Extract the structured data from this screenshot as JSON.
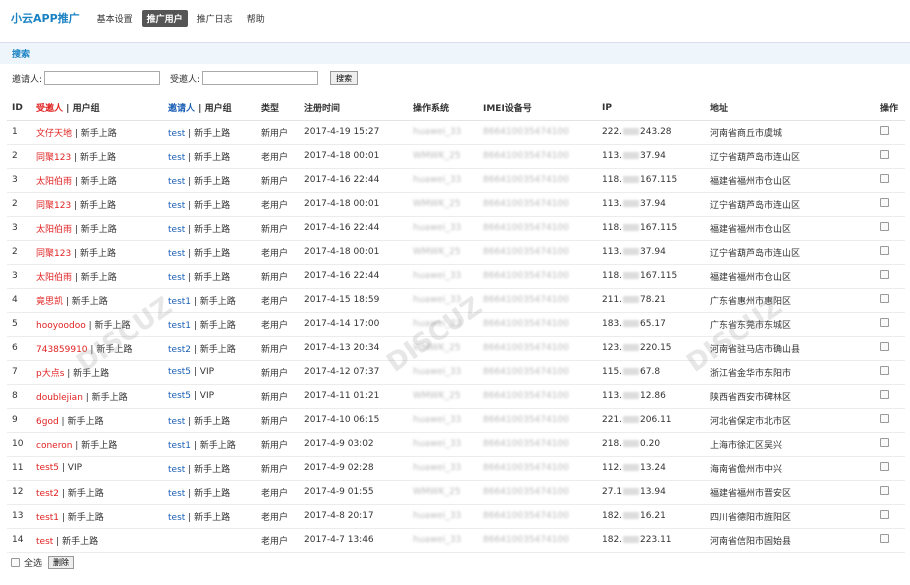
{
  "nav": {
    "brand": "小云APP推广",
    "items": [
      {
        "label": "基本设置",
        "active": false
      },
      {
        "label": "推广用户",
        "active": true
      },
      {
        "label": "推广日志",
        "active": false
      },
      {
        "label": "帮助",
        "active": false
      }
    ]
  },
  "search": {
    "title": "搜索",
    "inviter_label": "邀请人:",
    "invitee_label": "受邀人:",
    "inviter_value": "",
    "invitee_value": "",
    "button": "搜索"
  },
  "table": {
    "headers": {
      "id": "ID",
      "invitee": "受邀人",
      "invitee_group": "用户组",
      "inviter": "邀请人",
      "inviter_group": "用户组",
      "type": "类型",
      "regtime": "注册时间",
      "os": "操作系统",
      "imei": "IMEI设备号",
      "ip": "IP",
      "address": "地址",
      "action": "操作"
    },
    "rows": [
      {
        "id": "1",
        "invitee": "文仔天地",
        "ig": "新手上路",
        "inviter": "test",
        "rg": "新手上路",
        "type": "新用户",
        "time": "2017-4-19 15:27",
        "os": "huawei_33",
        "imei": "866410035474100",
        "ip_a": "222.",
        "ip_b": "243.28",
        "addr": "河南省商丘市虞城"
      },
      {
        "id": "2",
        "invitee": "同聚123",
        "ig": "新手上路",
        "inviter": "test",
        "rg": "新手上路",
        "type": "老用户",
        "time": "2017-4-18 00:01",
        "os": "WMWK_25",
        "imei": "866410035474100",
        "ip_a": "113.",
        "ip_b": "37.94",
        "addr": "辽宁省葫芦岛市连山区"
      },
      {
        "id": "3",
        "invitee": "太阳伯雨",
        "ig": "新手上路",
        "inviter": "test",
        "rg": "新手上路",
        "type": "新用户",
        "time": "2017-4-16 22:44",
        "os": "huawei_33",
        "imei": "866410035474100",
        "ip_a": "118.",
        "ip_b": "167.115",
        "addr": "福建省福州市仓山区"
      },
      {
        "id": "2",
        "invitee": "同聚123",
        "ig": "新手上路",
        "inviter": "test",
        "rg": "新手上路",
        "type": "老用户",
        "time": "2017-4-18 00:01",
        "os": "WMWK_25",
        "imei": "866410035474100",
        "ip_a": "113.",
        "ip_b": "37.94",
        "addr": "辽宁省葫芦岛市连山区"
      },
      {
        "id": "3",
        "invitee": "太阳伯雨",
        "ig": "新手上路",
        "inviter": "test",
        "rg": "新手上路",
        "type": "新用户",
        "time": "2017-4-16 22:44",
        "os": "huawei_33",
        "imei": "866410035474100",
        "ip_a": "118.",
        "ip_b": "167.115",
        "addr": "福建省福州市仓山区"
      },
      {
        "id": "2",
        "invitee": "同聚123",
        "ig": "新手上路",
        "inviter": "test",
        "rg": "新手上路",
        "type": "老用户",
        "time": "2017-4-18 00:01",
        "os": "WMWK_25",
        "imei": "866410035474100",
        "ip_a": "113.",
        "ip_b": "37.94",
        "addr": "辽宁省葫芦岛市连山区"
      },
      {
        "id": "3",
        "invitee": "太阳伯雨",
        "ig": "新手上路",
        "inviter": "test",
        "rg": "新手上路",
        "type": "新用户",
        "time": "2017-4-16 22:44",
        "os": "huawei_33",
        "imei": "866410035474100",
        "ip_a": "118.",
        "ip_b": "167.115",
        "addr": "福建省福州市仓山区"
      },
      {
        "id": "4",
        "invitee": "竟思凯",
        "ig": "新手上路",
        "inviter": "test1",
        "rg": "新手上路",
        "type": "老用户",
        "time": "2017-4-15 18:59",
        "os": "huawei_33",
        "imei": "866410035474100",
        "ip_a": "211.",
        "ip_b": "78.21",
        "addr": "广东省惠州市惠阳区"
      },
      {
        "id": "5",
        "invitee": "hooyoodoo",
        "ig": "新手上路",
        "inviter": "test1",
        "rg": "新手上路",
        "type": "老用户",
        "time": "2017-4-14 17:00",
        "os": "huawei_33",
        "imei": "866410035474100",
        "ip_a": "183.",
        "ip_b": "65.17",
        "addr": "广东省东莞市东城区"
      },
      {
        "id": "6",
        "invitee": "743859910",
        "ig": "新手上路",
        "inviter": "test2",
        "rg": "新手上路",
        "type": "新用户",
        "time": "2017-4-13 20:34",
        "os": "WMWK_25",
        "imei": "866410035474100",
        "ip_a": "123.",
        "ip_b": "220.15",
        "addr": "河南省驻马店市确山县"
      },
      {
        "id": "7",
        "invitee": "p大点s",
        "ig": "新手上路",
        "inviter": "test5",
        "rg": "VIP",
        "type": "新用户",
        "time": "2017-4-12 07:37",
        "os": "huawei_33",
        "imei": "866410035474100",
        "ip_a": "115.",
        "ip_b": "67.8",
        "addr": "浙江省金华市东阳市"
      },
      {
        "id": "8",
        "invitee": "doublejian",
        "ig": "新手上路",
        "inviter": "test5",
        "rg": "VIP",
        "type": "新用户",
        "time": "2017-4-11 01:21",
        "os": "WMWK_25",
        "imei": "866410035474100",
        "ip_a": "113.",
        "ip_b": "12.86",
        "addr": "陕西省西安市碑林区"
      },
      {
        "id": "9",
        "invitee": "6god",
        "ig": "新手上路",
        "inviter": "test",
        "rg": "新手上路",
        "type": "新用户",
        "time": "2017-4-10 06:15",
        "os": "huawei_33",
        "imei": "866410035474100",
        "ip_a": "221.",
        "ip_b": "206.11",
        "addr": "河北省保定市北市区"
      },
      {
        "id": "10",
        "invitee": "coneron",
        "ig": "新手上路",
        "inviter": "test1",
        "rg": "新手上路",
        "type": "新用户",
        "time": "2017-4-9 03:02",
        "os": "huawei_33",
        "imei": "866410035474100",
        "ip_a": "218.",
        "ip_b": "0.20",
        "addr": "上海市徐汇区吴兴"
      },
      {
        "id": "11",
        "invitee": "test5",
        "ig": "VIP",
        "inviter": "test",
        "rg": "新手上路",
        "type": "新用户",
        "time": "2017-4-9 02:28",
        "os": "huawei_33",
        "imei": "866410035474100",
        "ip_a": "112.",
        "ip_b": "13.24",
        "addr": "海南省儋州市中兴"
      },
      {
        "id": "12",
        "invitee": "test2",
        "ig": "新手上路",
        "inviter": "test",
        "rg": "新手上路",
        "type": "老用户",
        "time": "2017-4-9 01:55",
        "os": "WMWK_25",
        "imei": "866410035474100",
        "ip_a": "27.1",
        "ip_b": "13.94",
        "addr": "福建省福州市晋安区"
      },
      {
        "id": "13",
        "invitee": "test1",
        "ig": "新手上路",
        "inviter": "test",
        "rg": "新手上路",
        "type": "老用户",
        "time": "2017-4-8 20:17",
        "os": "huawei_33",
        "imei": "866410035474100",
        "ip_a": "182.",
        "ip_b": "16.21",
        "addr": "四川省德阳市旌阳区"
      },
      {
        "id": "14",
        "invitee": "test",
        "ig": "新手上路",
        "inviter": "",
        "rg": "",
        "type": "老用户",
        "time": "2017-4-7 13:46",
        "os": "huawei_33",
        "imei": "866410035474100",
        "ip_a": "182.",
        "ip_b": "223.11",
        "addr": "河南省信阳市固始县"
      }
    ]
  },
  "footer": {
    "select_all": "全选",
    "delete": "删除"
  }
}
